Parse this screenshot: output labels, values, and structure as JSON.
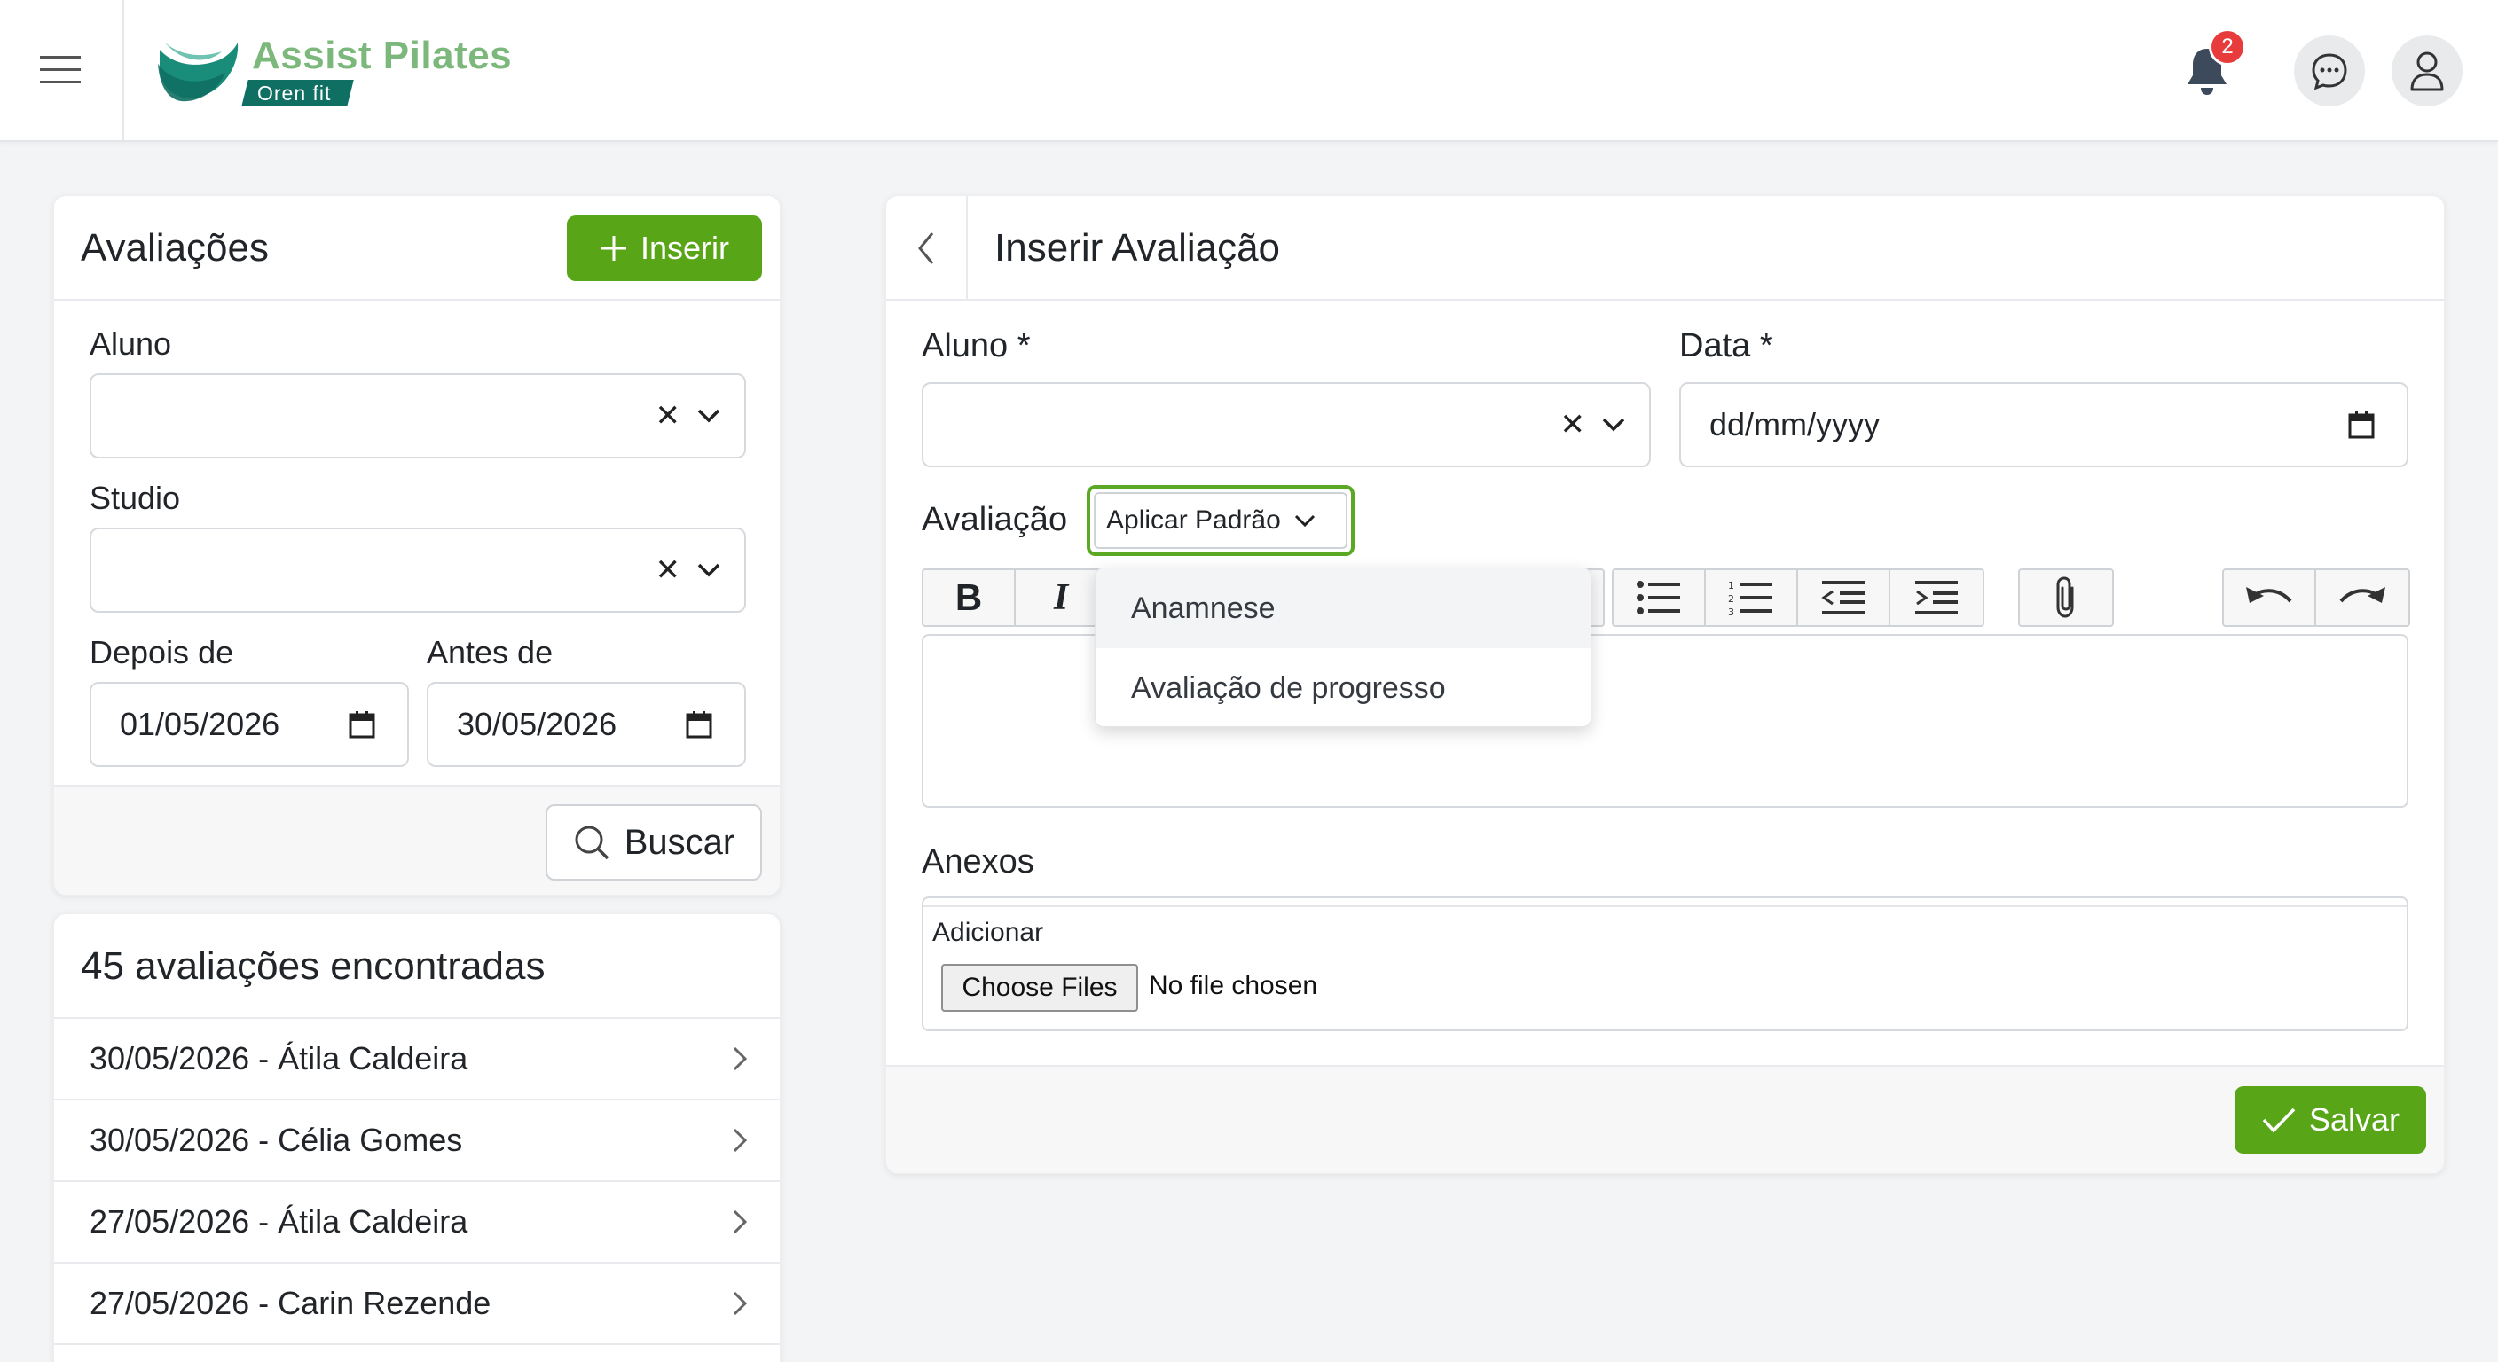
{
  "app": {
    "brand_name": "Assist Pilates",
    "brand_sub": "Oren fit",
    "notification_count": "2",
    "colors": {
      "accent": "#58a618",
      "brand_teal": "#0f6f62",
      "brand_green": "#7cb87c",
      "badge": "#e83b3b"
    }
  },
  "icons": [
    "hamburger-menu-icon",
    "bell-icon",
    "chat-icon",
    "user-icon",
    "plus-icon",
    "search-icon",
    "calendar-icon",
    "chevron-left-icon",
    "chevron-right-icon",
    "chevron-down-icon",
    "close-icon",
    "check-icon",
    "paperclip-icon",
    "undo-icon",
    "redo-icon"
  ],
  "filters": {
    "title": "Avaliações",
    "insert_label": "Inserir",
    "aluno_label": "Aluno",
    "studio_label": "Studio",
    "depois_label": "Depois de",
    "depois_value": "01/05/2026",
    "antes_label": "Antes de",
    "antes_value": "30/05/2026",
    "buscar_label": "Buscar"
  },
  "results": {
    "title": "45 avaliações encontradas",
    "items": [
      {
        "label": "30/05/2026 - Átila Caldeira"
      },
      {
        "label": "30/05/2026 - Célia Gomes"
      },
      {
        "label": "27/05/2026 - Átila Caldeira"
      },
      {
        "label": "27/05/2026 - Carin Rezende"
      }
    ]
  },
  "form": {
    "title": "Inserir Avaliação",
    "aluno_label": "Aluno *",
    "data_label": "Data *",
    "data_placeholder": "dd/mm/yyyy",
    "avaliacao_label": "Avaliação",
    "aplicar_label": "Aplicar Padrão",
    "dropdown_options": [
      "Anamnese",
      "Avaliação de progresso"
    ],
    "toolbar": {
      "bold": "B",
      "italic": "I"
    },
    "anexos_label": "Anexos",
    "adicionar_label": "Adicionar",
    "choose_files": "Choose Files",
    "no_file": "No file chosen",
    "salvar_label": "Salvar"
  }
}
